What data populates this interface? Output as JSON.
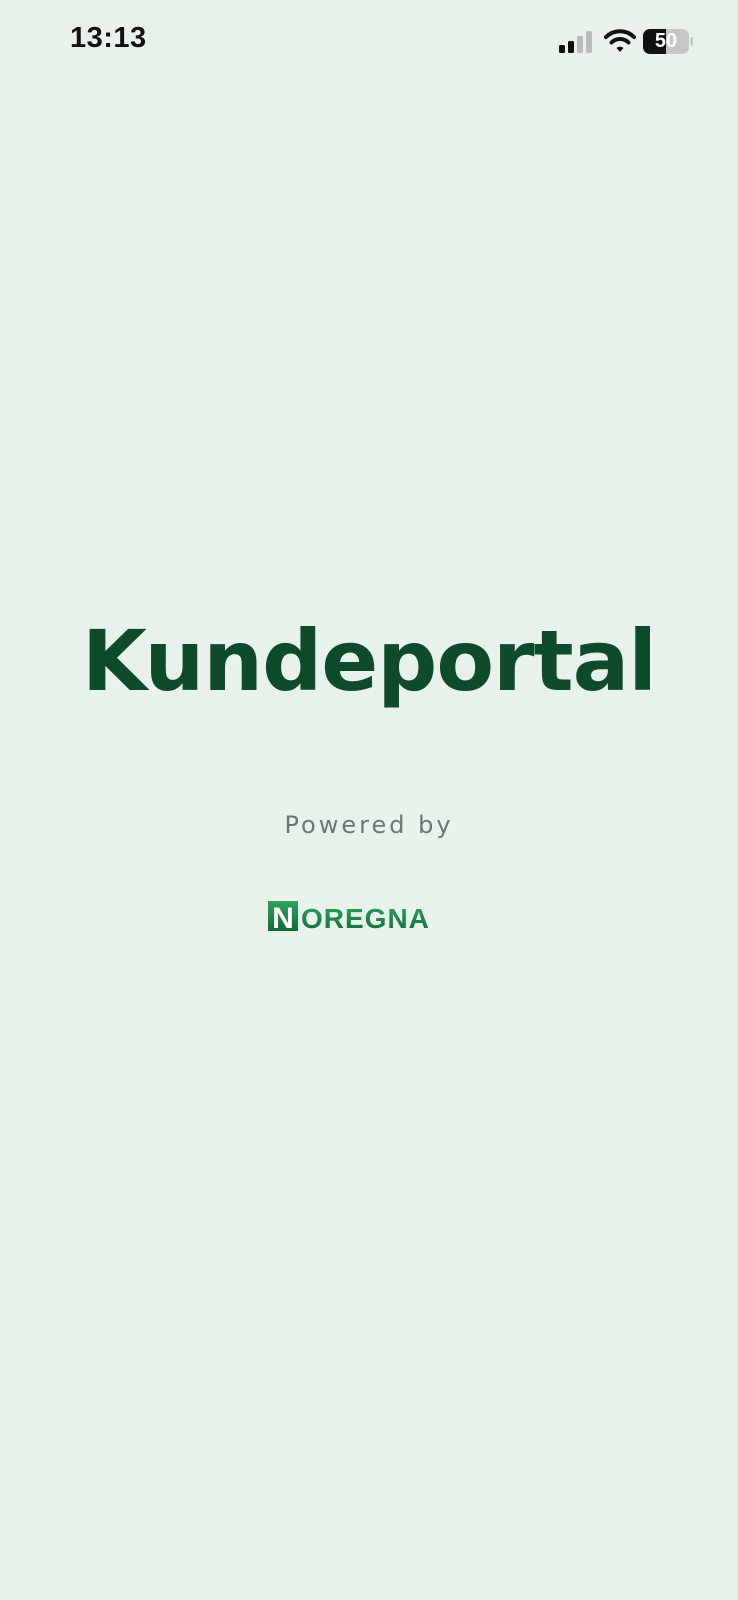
{
  "status_bar": {
    "time": "13:13",
    "battery_level": "50",
    "icons": [
      "signal-icon",
      "wifi-icon",
      "battery-icon"
    ]
  },
  "splash": {
    "title": "Kundeportal",
    "powered_by": "Powered by",
    "logo_text": "NOREGNA"
  },
  "colors": {
    "background": "#e8f2ea",
    "title": "#0e4a2c",
    "logo_green": "#1f8a4c",
    "subtle_text": "#6d7670"
  }
}
